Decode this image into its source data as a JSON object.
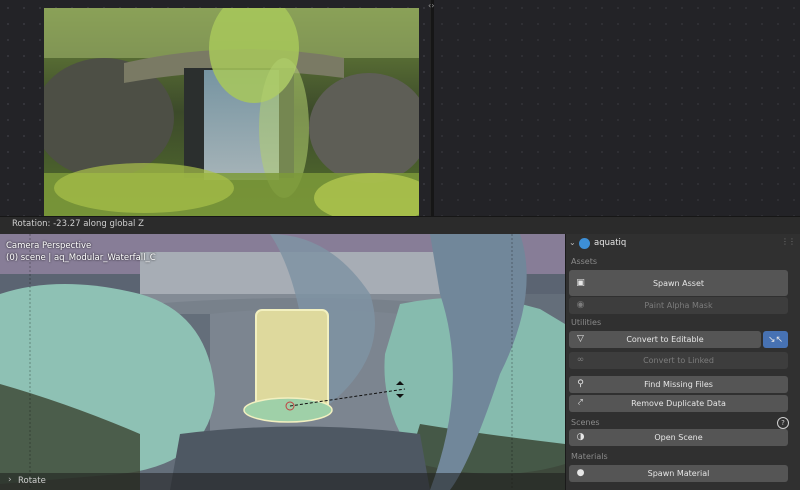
{
  "status_bar": {
    "text": "Rotation: -23.27 along global Z"
  },
  "viewport": {
    "view_name": "Camera Perspective",
    "object_info": "(0) scene | aq_Modular_Waterfall_C"
  },
  "last_operator": {
    "label": "Rotate"
  },
  "panel": {
    "title": "aquatiq",
    "sections": {
      "assets": "Assets",
      "utilities": "Utilities",
      "scenes": "Scenes",
      "materials": "Materials"
    },
    "buttons": {
      "spawn_asset": "Spawn Asset",
      "paint_alpha_mask": "Paint Alpha Mask",
      "convert_to_editable": "Convert to Editable",
      "convert_to_linked": "Convert to Linked",
      "find_missing_files": "Find Missing Files",
      "remove_duplicate_data": "Remove Duplicate Data",
      "open_scene": "Open Scene",
      "spawn_material": "Spawn Material"
    },
    "colors": {
      "accent": "#4772b3",
      "button": "#555555",
      "panel": "#303030"
    }
  }
}
